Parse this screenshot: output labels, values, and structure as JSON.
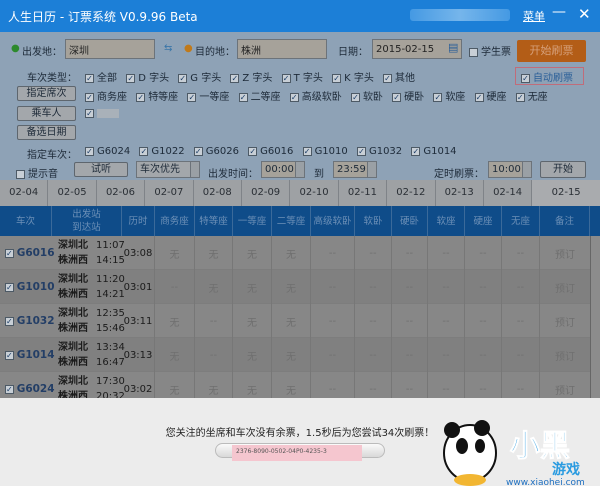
{
  "window": {
    "title": "人生日历 - 订票系统 V0.9.96 Beta",
    "menu": "菜单",
    "minimize": "—",
    "close": "✕"
  },
  "search": {
    "from_label": "出发地：",
    "from_value": "深圳",
    "to_label": "目的地：",
    "to_value": "株洲",
    "date_label": "日期：",
    "date_value": "2015-02-15",
    "student_label": "学生票",
    "student_checked": false,
    "start_button": "开始刷票"
  },
  "train_types": {
    "label": "车次类型：",
    "items": [
      "全部",
      "D 字头",
      "G 字头",
      "Z 字头",
      "T 字头",
      "K 字头",
      "其他"
    ]
  },
  "auto_refresh": {
    "label": "自动刷票",
    "checked": true
  },
  "seat_button": "指定席次",
  "seats": [
    "商务座",
    "特等座",
    "一等座",
    "二等座",
    "高级软卧",
    "软卧",
    "硬卧",
    "软座",
    "硬座",
    "无座"
  ],
  "passenger_button": "乘车人",
  "alt_date_button": "备选日期",
  "trains": {
    "label": "指定车次：",
    "items": [
      "G6024",
      "G1022",
      "G6026",
      "G6016",
      "G1010",
      "G1032",
      "G1014"
    ]
  },
  "controls": {
    "sound_label": "提示音",
    "sound_checked": false,
    "listen_button": "试听",
    "priority_select": "车次优先",
    "depart_label": "出发时间：",
    "time_from": "00:00",
    "to_label": "到",
    "time_to": "23:59",
    "timer_label": "定时刷票：",
    "timer_value": "10:00",
    "go_button": "开始"
  },
  "date_tabs": [
    "02-04",
    "02-05",
    "02-06",
    "02-07",
    "02-08",
    "02-09",
    "02-10",
    "02-11",
    "02-12",
    "02-13",
    "02-14",
    "02-15"
  ],
  "active_date": "02-15",
  "table": {
    "headers": [
      "车次",
      "出发站",
      "到达站",
      "历时",
      "商务座",
      "特等座",
      "一等座",
      "二等座",
      "高级软卧",
      "软卧",
      "硬卧",
      "软座",
      "硬座",
      "无座",
      "备注"
    ],
    "rows": [
      {
        "train": "G6016",
        "from": "深圳北",
        "to": "株洲西",
        "dep": "11:07",
        "arr": "14:15",
        "dur": "03:08",
        "seats": [
          "无",
          "无",
          "无",
          "无",
          "--",
          "--",
          "--",
          "--",
          "--",
          "--"
        ],
        "remark": "预订"
      },
      {
        "train": "G1010",
        "from": "深圳北",
        "to": "株洲西",
        "dep": "11:20",
        "arr": "14:21",
        "dur": "03:01",
        "seats": [
          "--",
          "无",
          "无",
          "无",
          "--",
          "--",
          "--",
          "--",
          "--",
          "--"
        ],
        "remark": "预订"
      },
      {
        "train": "G1032",
        "from": "深圳北",
        "to": "株洲西",
        "dep": "12:35",
        "arr": "15:46",
        "dur": "03:11",
        "seats": [
          "无",
          "--",
          "无",
          "无",
          "--",
          "--",
          "--",
          "--",
          "--",
          "--"
        ],
        "remark": "预订"
      },
      {
        "train": "G1014",
        "from": "深圳北",
        "to": "株洲西",
        "dep": "13:34",
        "arr": "16:47",
        "dur": "03:13",
        "seats": [
          "无",
          "--",
          "无",
          "无",
          "--",
          "--",
          "--",
          "--",
          "--",
          "--"
        ],
        "remark": "预订"
      },
      {
        "train": "G6024",
        "from": "深圳北",
        "to": "株洲西",
        "dep": "17:30",
        "arr": "20:32",
        "dur": "03:02",
        "seats": [
          "无",
          "无",
          "无",
          "无",
          "--",
          "--",
          "--",
          "--",
          "--",
          "--"
        ],
        "remark": "预订"
      }
    ]
  },
  "status": {
    "message": "您关注的坐席和车次没有余票，1.5秒后为您尝试34次刷票！",
    "ticket_code": "2376-8090-0502-04P0-4235-3"
  },
  "watermark": {
    "brand": "小黑游戏",
    "url": "www.xiaohei.com"
  },
  "colors": {
    "titlebar": "#1c7fd7",
    "start_button": "#b35d17",
    "table_header": "#0f4c89"
  }
}
